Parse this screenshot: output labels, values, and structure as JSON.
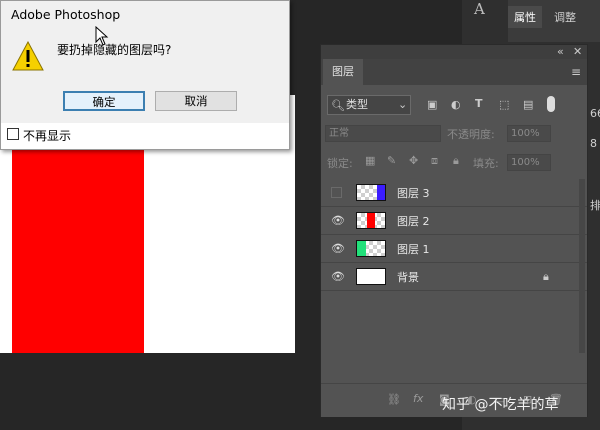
{
  "dialog": {
    "title": "Adobe Photoshop",
    "message": "要扔掉隐藏的图层吗?",
    "ok_label": "确定",
    "cancel_label": "取消",
    "dont_show_label": "不再显示",
    "dont_show_checked": false
  },
  "right_panel": {
    "tab_properties": "属性",
    "tab_adjust": "调整",
    "peek_1": "66",
    "peek_2": "8",
    "peek_3": "排"
  },
  "layers_panel": {
    "tab_label": "图层",
    "filter_label": "类型",
    "blend_mode": "正常",
    "opacity_label": "不透明度:",
    "opacity_value": "100%",
    "lock_label": "锁定:",
    "fill_label": "填充:",
    "fill_value": "100%",
    "layers": [
      {
        "name": "图层 3",
        "visible": false,
        "swatch": "#3b1cff"
      },
      {
        "name": "图层 2",
        "visible": true,
        "swatch": "#ff0000"
      },
      {
        "name": "图层 1",
        "visible": true,
        "swatch": "#22e07a"
      },
      {
        "name": "背景",
        "visible": true,
        "locked": true
      }
    ],
    "footer_fx": "fx"
  },
  "watermark": "知乎 @不吃羊的草",
  "colors": {
    "canvas_red": "#ff0000",
    "panel_bg": "#535353",
    "app_bg": "#262626"
  }
}
